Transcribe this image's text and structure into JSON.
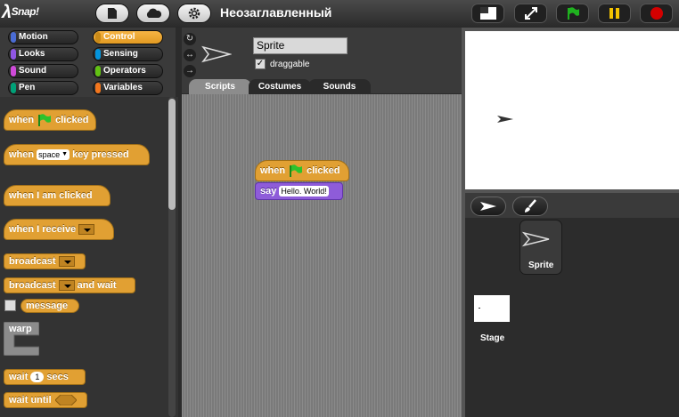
{
  "app": {
    "logo": "Snap!",
    "project_title": "Неозаглавленный"
  },
  "toolbar": {
    "file_icon": "file-icon",
    "cloud_icon": "cloud-icon",
    "settings_icon": "gear-icon",
    "stage_size_icon": "stage-size-icon",
    "fullscreen_icon": "fullscreen-icon",
    "green_flag_icon": "green-flag-icon",
    "pause_icon": "pause-icon",
    "stop_icon": "stop-icon",
    "colors": {
      "flag": "#1fb21f",
      "pause": "#f4c400",
      "stop": "#d40000"
    }
  },
  "categories": [
    {
      "label": "Motion",
      "color": "#4a6cd4"
    },
    {
      "label": "Control",
      "color": "#e6a822",
      "active": true
    },
    {
      "label": "Looks",
      "color": "#8f56e3"
    },
    {
      "label": "Sensing",
      "color": "#0494dc"
    },
    {
      "label": "Sound",
      "color": "#cf4ad9"
    },
    {
      "label": "Operators",
      "color": "#62c213"
    },
    {
      "label": "Pen",
      "color": "#00a178"
    },
    {
      "label": "Variables",
      "color": "#f3761d"
    }
  ],
  "palette": {
    "when_flag": {
      "when": "when",
      "clicked": "clicked"
    },
    "when_key": {
      "when": "when",
      "key": "space",
      "rest": "key pressed"
    },
    "when_clicked": "when I am clicked",
    "when_receive": "when I receive",
    "broadcast": "broadcast",
    "broadcast_wait": {
      "label": "broadcast",
      "and_wait": "and wait"
    },
    "message": "message",
    "warp": "warp",
    "wait": {
      "label": "wait",
      "value": "1",
      "unit": "secs"
    },
    "wait_until": "wait until"
  },
  "sprite": {
    "name": "Sprite",
    "draggable_label": "draggable",
    "draggable_checked": "✓",
    "rotation_icons": [
      "rotate-icon",
      "flip-icon",
      "no-rotate-icon"
    ],
    "rotation_glyphs": [
      "↻",
      "↔",
      "→"
    ]
  },
  "tabs": [
    "Scripts",
    "Costumes",
    "Sounds"
  ],
  "script": {
    "hat": {
      "when": "when",
      "clicked": "clicked"
    },
    "say": {
      "label": "say",
      "text": "Hello. World!"
    }
  },
  "corral": {
    "sprite_label": "Sprite",
    "stage_label": "Stage",
    "turtle_button_icon": "turtle-icon",
    "paint_button_icon": "paintbrush-icon"
  }
}
